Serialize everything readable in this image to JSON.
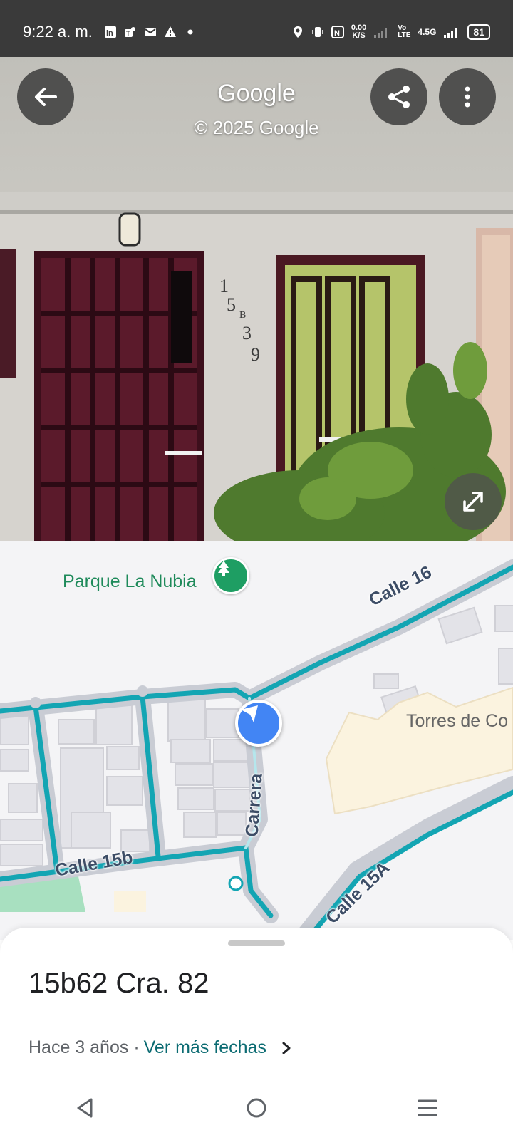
{
  "status_bar": {
    "time": "9:22 a. m.",
    "data_speed_value": "0.00",
    "data_speed_unit": "K/S",
    "volte": "Vo\nLTE",
    "network": "4.5G",
    "battery": "81",
    "icons_left": [
      "linkedin-icon",
      "teams-icon",
      "outlook-icon",
      "warning-icon",
      "dot-icon"
    ],
    "icons_right": [
      "location-icon",
      "vibrate-icon",
      "nfc-icon",
      "signal-icon",
      "signal-icon",
      "battery-icon"
    ]
  },
  "header": {
    "title": "Google",
    "subtitle": "© 2025 Google"
  },
  "map": {
    "park_label": "Parque La Nubia",
    "torres_label": "Torres de Co",
    "streets": {
      "calle16": "Calle 16",
      "calle15b": "Calle 15b",
      "carrera": "Carrera",
      "calle15a": "Calle 15A"
    }
  },
  "sheet": {
    "address": "15b62 Cra. 82",
    "age": "Hace 3 años ·",
    "more_dates": "Ver más fechas"
  },
  "colors": {
    "accent_teal": "#0b6b72",
    "road_teal": "#13a5b3",
    "location_blue": "#4285f4",
    "park_green": "#1e9e63"
  }
}
